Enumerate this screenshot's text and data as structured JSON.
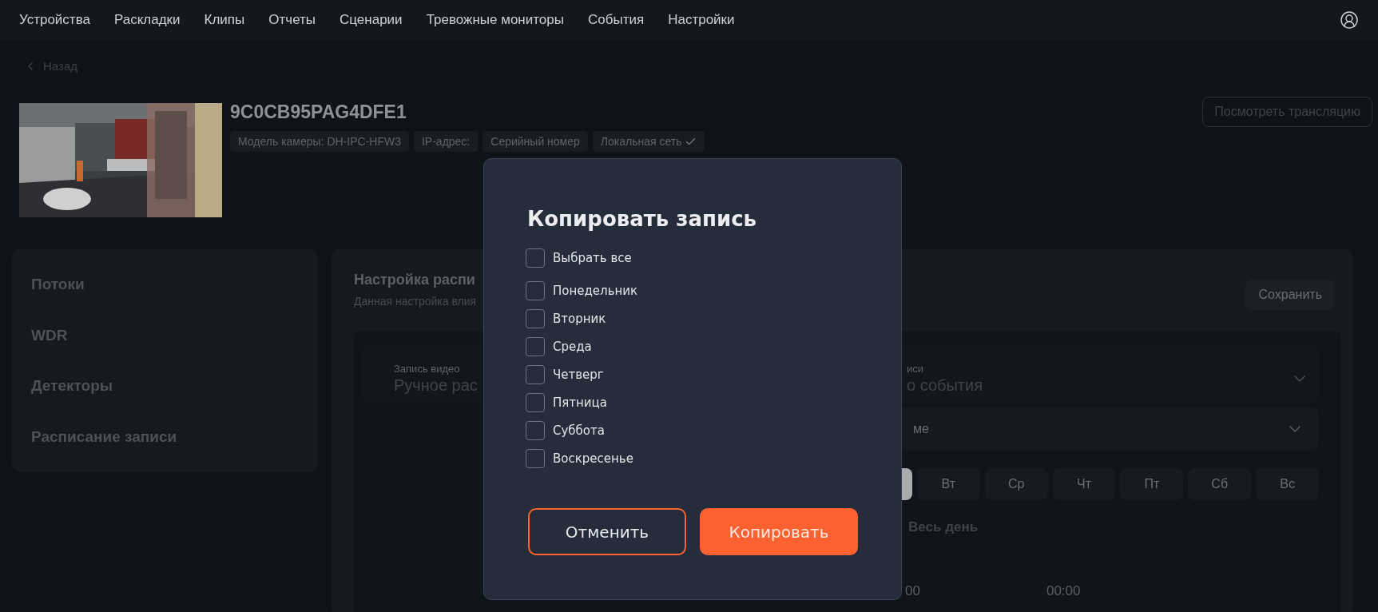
{
  "nav": {
    "items": [
      "Устройства",
      "Раскладки",
      "Клипы",
      "Отчеты",
      "Сценарии",
      "Тревожные мониторы",
      "События",
      "Настройки"
    ]
  },
  "back": {
    "label": "Назад"
  },
  "camera": {
    "title": "9C0CB95PAG4DFE1",
    "watch_button": "Посмотреть трансляцию",
    "chips": [
      {
        "label": "Модель камеры: DH-IPC-HFW3",
        "checked": false
      },
      {
        "label": "IP-адрес:",
        "checked": false
      },
      {
        "label": "Серийный номер",
        "checked": false
      },
      {
        "label": "Локальная сеть",
        "checked": true
      }
    ]
  },
  "sidebar": {
    "items": [
      "Потоки",
      "WDR",
      "Детекторы",
      "Расписание записи"
    ]
  },
  "schedule": {
    "title": "Настройка распи",
    "subtitle": "Данная настройка влия",
    "save_button": "Сохранить",
    "video_field": {
      "label": "Запись видео",
      "value": "Ручное рас"
    },
    "mode_field": {
      "label": "иси",
      "value": "о события"
    },
    "select": {
      "value": "ме"
    },
    "days": [
      {
        "selected": true
      },
      {
        "label": "Вт",
        "selected": false
      },
      {
        "label": "Ср",
        "selected": false
      },
      {
        "label": "Чт",
        "selected": false
      },
      {
        "label": "Пт",
        "selected": false
      },
      {
        "label": "Сб",
        "selected": false
      },
      {
        "label": "Вс",
        "selected": false
      }
    ],
    "all_day": "Весь день",
    "times": [
      "00",
      "00:00"
    ]
  },
  "dialog": {
    "title": "Копировать запись",
    "options": [
      {
        "label": "Выбрать все",
        "checked": false
      },
      {
        "label": "Понедельник",
        "checked": false
      },
      {
        "label": "Вторник",
        "checked": false
      },
      {
        "label": "Среда",
        "checked": false
      },
      {
        "label": "Четверг",
        "checked": false
      },
      {
        "label": "Пятница",
        "checked": false
      },
      {
        "label": "Суббота",
        "checked": false
      },
      {
        "label": "Воскресенье",
        "checked": false
      }
    ],
    "cancel_button": "Отменить",
    "confirm_button": "Копировать"
  }
}
